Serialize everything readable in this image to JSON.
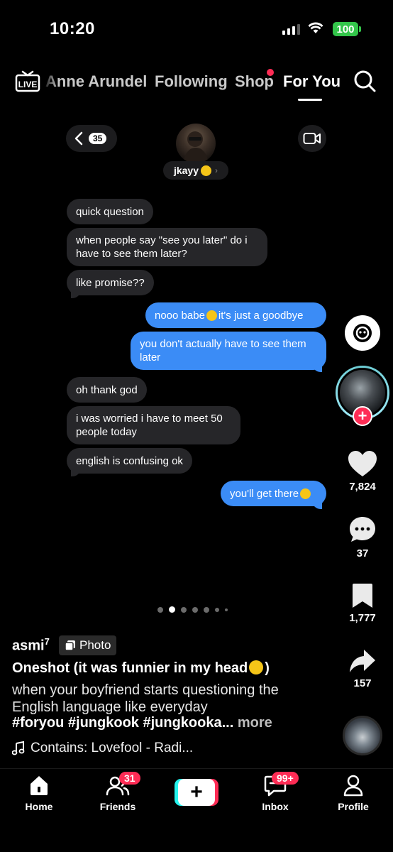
{
  "status_bar": {
    "time": "10:20",
    "battery": "100"
  },
  "top_nav": {
    "live_label": "LIVE",
    "tabs": [
      {
        "label": "Anne Arundel"
      },
      {
        "label": "Following"
      },
      {
        "label": "Shop"
      },
      {
        "label": "For You"
      }
    ],
    "active_tab": "For You"
  },
  "conversation": {
    "back_count": "35",
    "contact_name": "jkayy",
    "messages": [
      {
        "from": "them",
        "text": "quick question"
      },
      {
        "from": "them",
        "text": "when people say \"see you later\" do i have to see them later?"
      },
      {
        "from": "them",
        "text": "like promise??"
      },
      {
        "from": "me",
        "text_before": "nooo babe",
        "text_after": "it's just a goodbye"
      },
      {
        "from": "me",
        "text": "you don't actually have to see them later"
      },
      {
        "from": "them",
        "text": "oh thank god"
      },
      {
        "from": "them",
        "text": "i was worried i have to meet 50 people today"
      },
      {
        "from": "them",
        "text": "english is confusing ok"
      },
      {
        "from": "me",
        "text": "you'll get there"
      }
    ]
  },
  "right_rail": {
    "likes": "7,824",
    "comments": "37",
    "saves": "1,777",
    "shares": "157"
  },
  "carousel": {
    "total": 7,
    "active_index": 1
  },
  "caption": {
    "author": "asmi",
    "author_suffix": "7",
    "post_type": "Photo",
    "title": "Oneshot (it was funnier in my head",
    "title_close": ")",
    "description": "when your boyfriend starts questioning the English language like everyday",
    "hashtags": "#foryou #jungkook #jungkooka...",
    "more_label": "more",
    "music": "Contains: Lovefool - Radi..."
  },
  "bottom_nav": {
    "home": "Home",
    "friends": "Friends",
    "friends_badge": "31",
    "inbox": "Inbox",
    "inbox_badge": "99+",
    "profile": "Profile"
  },
  "colors": {
    "accent_red": "#fe2c55",
    "accent_cyan": "#25f4ee",
    "bubble_blue": "#3b8cf6",
    "bubble_gray": "#262629",
    "battery_green": "#33c54a"
  }
}
